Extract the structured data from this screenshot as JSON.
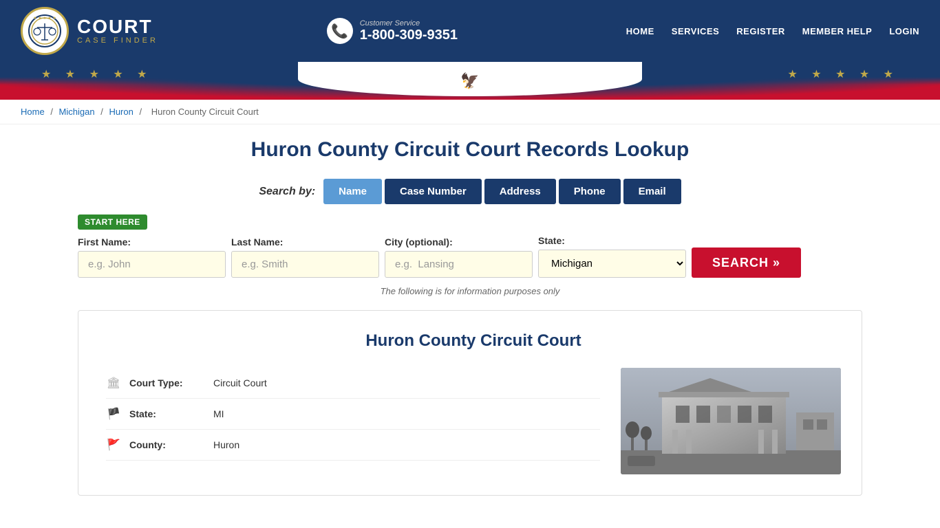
{
  "header": {
    "logo_court": "COURT",
    "logo_case_finder": "CASE FINDER",
    "customer_service_label": "Customer Service",
    "customer_service_number": "1-800-309-9351",
    "nav": {
      "home": "HOME",
      "services": "SERVICES",
      "register": "REGISTER",
      "member_help": "MEMBER HELP",
      "login": "LOGIN"
    }
  },
  "breadcrumb": {
    "home": "Home",
    "michigan": "Michigan",
    "huron": "Huron",
    "current": "Huron County Circuit Court"
  },
  "page": {
    "title": "Huron County Circuit Court Records Lookup"
  },
  "search": {
    "by_label": "Search by:",
    "tabs": [
      {
        "id": "name",
        "label": "Name",
        "active": true
      },
      {
        "id": "case-number",
        "label": "Case Number",
        "active": false
      },
      {
        "id": "address",
        "label": "Address",
        "active": false
      },
      {
        "id": "phone",
        "label": "Phone",
        "active": false
      },
      {
        "id": "email",
        "label": "Email",
        "active": false
      }
    ],
    "start_here": "START HERE",
    "form": {
      "first_name_label": "First Name:",
      "first_name_placeholder": "e.g. John",
      "last_name_label": "Last Name:",
      "last_name_placeholder": "e.g. Smith",
      "city_label": "City (optional):",
      "city_placeholder": "e.g.  Lansing",
      "state_label": "State:",
      "state_value": "Michigan",
      "search_button": "SEARCH »"
    },
    "info_note": "The following is for information purposes only"
  },
  "court": {
    "title": "Huron County Circuit Court",
    "details": [
      {
        "icon": "building",
        "label": "Court Type:",
        "value": "Circuit Court"
      },
      {
        "icon": "flag-outline",
        "label": "State:",
        "value": "MI"
      },
      {
        "icon": "flag",
        "label": "County:",
        "value": "Huron"
      }
    ]
  }
}
